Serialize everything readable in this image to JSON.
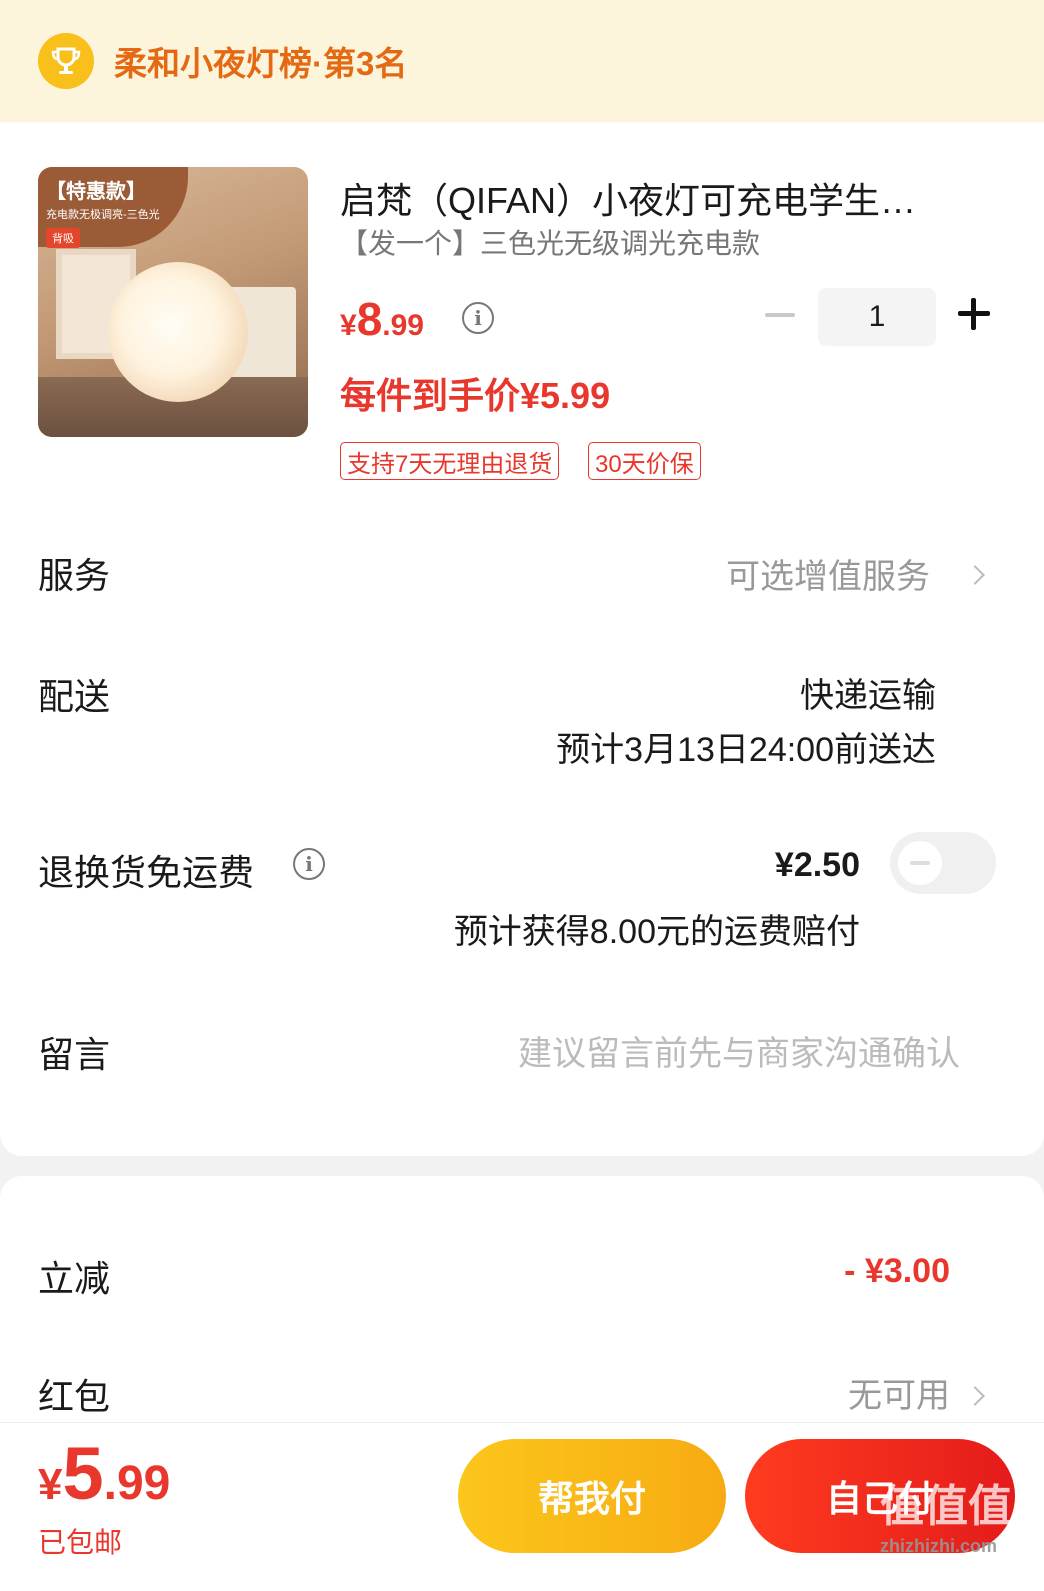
{
  "rank_banner": {
    "text": "柔和小夜灯榜·第3名"
  },
  "product": {
    "image_tag_title": "【特惠款】",
    "image_tag_subtitle": "充电款无极调亮-三色光",
    "image_tag_badge": "背吸",
    "title": "启梵（QIFAN）小夜灯可充电学生…",
    "spec": "【发一个】三色光无级调光充电款",
    "price_currency": "¥",
    "price_int": "8",
    "price_dec": ".99",
    "final_price_text": "每件到手价¥5.99",
    "tags": [
      "支持7天无理由退货",
      "30天价保"
    ],
    "quantity": "1"
  },
  "rows": {
    "service_label": "服务",
    "service_value": "可选增值服务",
    "delivery_label": "配送",
    "delivery_method": "快递运输",
    "delivery_eta": "预计3月13日24:00前送达",
    "return_label": "退换货免运费",
    "return_price": "¥2.50",
    "return_note": "预计获得8.00元的运费赔付",
    "message_label": "留言",
    "message_placeholder": "建议留言前先与商家沟通确认"
  },
  "discounts": {
    "instant_label": "立减",
    "instant_value": "- ¥3.00",
    "redpacket_label": "红包",
    "redpacket_value": "无可用"
  },
  "bottom": {
    "total_currency": "¥",
    "total_int": "5",
    "total_dec": ".99",
    "free_shipping": "已包邮",
    "help_pay_label": "帮我付",
    "self_pay_label": "自己付"
  },
  "watermark": {
    "main": "值值值",
    "sub": "zhizhizhi.com"
  },
  "colors": {
    "accent_red": "#e8372c",
    "rank_orange": "#e36a13",
    "help_button": "#f7ab12",
    "self_button": "#e41b1b"
  }
}
